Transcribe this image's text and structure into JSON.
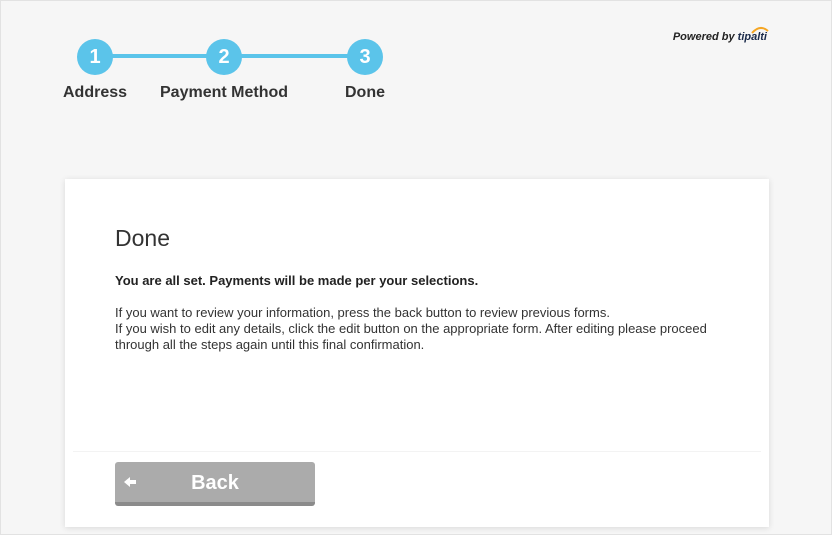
{
  "stepper": {
    "steps": [
      {
        "number": "1",
        "label": "Address"
      },
      {
        "number": "2",
        "label": "Payment Method"
      },
      {
        "number": "3",
        "label": "Done"
      }
    ],
    "accent_color": "#5bc4ea"
  },
  "branding": {
    "powered_by": "Powered by",
    "brand_name": "tipalti"
  },
  "card": {
    "title": "Done",
    "subtitle": "You are all set. Payments will be made per your selections.",
    "body_line_1": "If you want to review your information, press the back button to review previous forms.",
    "body_line_2": "If you wish to edit any details, click the edit button on the appropriate form. After editing please proceed through all the steps again until this final confirmation.",
    "back_button": {
      "label": "Back",
      "icon": "arrow-left-icon",
      "color": "#ababab"
    }
  }
}
